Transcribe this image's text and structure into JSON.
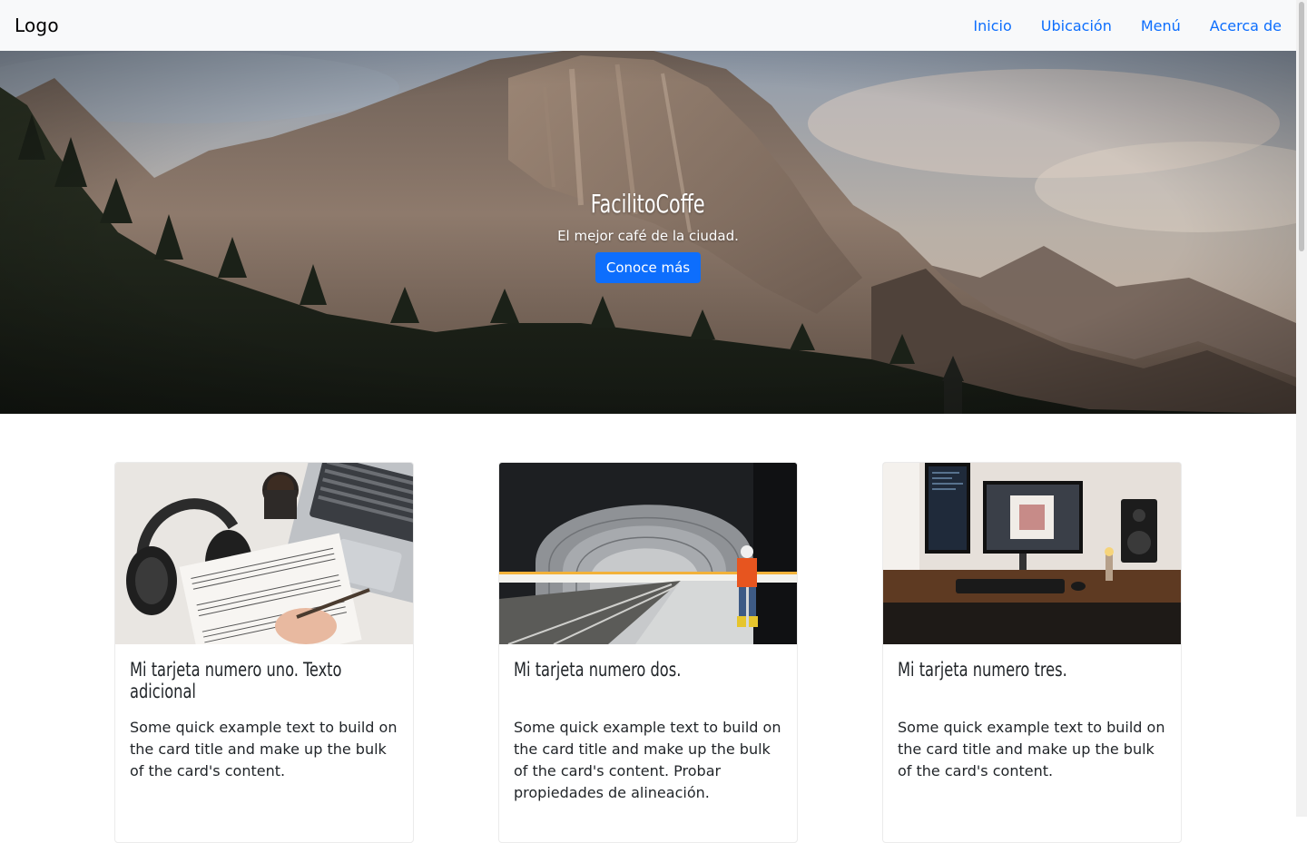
{
  "navbar": {
    "brand": "Logo",
    "links": [
      {
        "label": "Inicio"
      },
      {
        "label": "Ubicación"
      },
      {
        "label": "Menú"
      },
      {
        "label": "Acerca de"
      }
    ],
    "background": "#f8f9fa",
    "link_color": "#0d6efd"
  },
  "hero": {
    "title": "FacilitoCoffe",
    "subtitle": "El mejor café de la ciudad.",
    "button_label": "Conoce más",
    "image": "mountain-landscape-photo",
    "button_color": "#0d6efd"
  },
  "cards": [
    {
      "image": "headphones-laptop-sheet-music-photo",
      "title": "Mi tarjeta numero uno. Texto adicional",
      "text": "Some quick example text to build on the card title and make up the bulk of the card's content."
    },
    {
      "image": "subway-tunnel-worker-photo",
      "title": "Mi tarjeta numero dos.",
      "text": "Some quick example text to build on the card title and make up the bulk of the card's content. Probar propiedades de alineación."
    },
    {
      "image": "desk-setup-monitor-photo",
      "title": "Mi tarjeta numero tres.",
      "text": "Some quick example text to build on the card title and make up the bulk of the card's content."
    }
  ]
}
